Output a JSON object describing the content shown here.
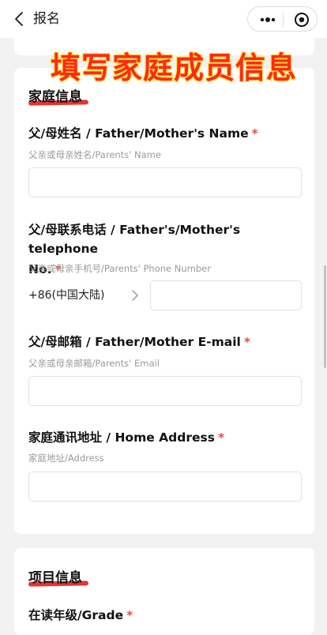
{
  "header": {
    "title": "报名"
  },
  "banner": {
    "text": "填写家庭成员信息"
  },
  "family_section": {
    "title": "家庭信息",
    "fields": [
      {
        "label": "父/母姓名 / Father/Mother's Name",
        "required": "*",
        "hint": "父亲或母亲姓名/Parents' Name",
        "value": ""
      },
      {
        "label_line1": "父/母联系电话 / Father's/Mother's telephone",
        "label_line2": "No.",
        "required": "*",
        "hint": "父亲或母亲手机号/Parents' Phone Number",
        "country_code": "+86(中国大陆)",
        "value": ""
      },
      {
        "label": "父/母邮箱 / Father/Mother E-mail",
        "required": "*",
        "hint": "父亲或母亲邮箱/Parents' Email",
        "value": ""
      },
      {
        "label": "家庭通讯地址 / Home Address",
        "required": "*",
        "hint": "家庭地址/Address",
        "value": ""
      }
    ]
  },
  "project_section": {
    "title": "项目信息",
    "fields": [
      {
        "label": "在读年级/Grade",
        "required": "*"
      }
    ]
  },
  "colors": {
    "required": "#e84a4a",
    "underline": "#e53434",
    "banner": "#ff2a10"
  }
}
